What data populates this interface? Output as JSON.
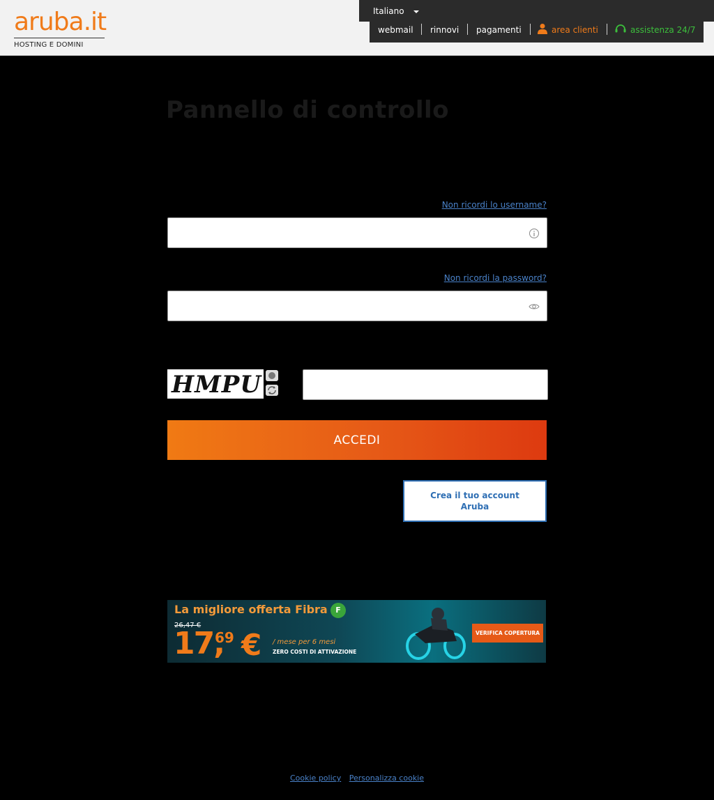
{
  "header": {
    "logo": {
      "brand": "aruba.it",
      "tagline": "HOSTING E DOMINI"
    },
    "language": {
      "selected": "Italiano"
    },
    "nav": {
      "webmail": "webmail",
      "rinnovi": "rinnovi",
      "pagamenti": "pagamenti",
      "area_clienti": "area clienti",
      "assistenza": "assistenza 24/7"
    }
  },
  "main": {
    "title": "Pannello di controllo",
    "forgot_username": "Non ricordi lo username?",
    "forgot_password": "Non ricordi la password?",
    "username_field": {
      "value": "",
      "placeholder": ""
    },
    "password_field": {
      "value": "",
      "placeholder": ""
    },
    "captcha": {
      "image_text": "HMPU",
      "input_value": ""
    },
    "login_button": "ACCEDI",
    "create_account_button": "Crea il tuo account Aruba"
  },
  "banner": {
    "title": "La migliore offerta Fibra",
    "badge": "F",
    "old_price": "26,47 €",
    "price_integer": "17,",
    "price_cents": "69",
    "currency": "€",
    "per_month": "/ mese per 6 mesi",
    "no_activation": "ZERO COSTI DI ATTIVAZIONE",
    "cta": "VERIFICA COPERTURA"
  },
  "footer": {
    "cookie_policy": "Cookie policy",
    "customize_cookie": "Personalizza cookie"
  },
  "colors": {
    "brand_orange": "#f07b1a",
    "link_blue": "#4a82c9",
    "help_green": "#3cbf3c",
    "button_blue": "#2f6fb4"
  }
}
